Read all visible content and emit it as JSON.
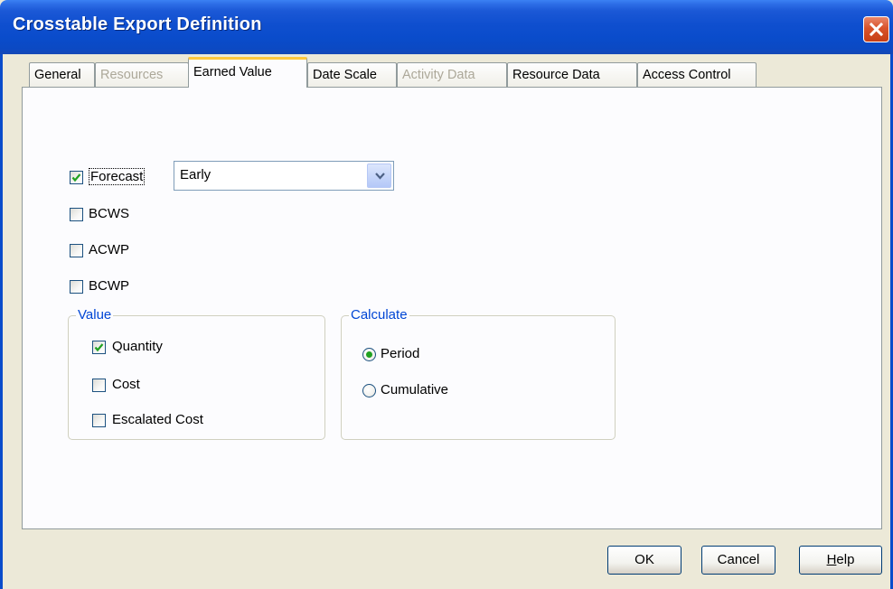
{
  "window": {
    "title": "Crosstable Export Definition"
  },
  "tabs": [
    {
      "label": "General",
      "state": "normal"
    },
    {
      "label": "Resources",
      "state": "disabled"
    },
    {
      "label": "Earned Value",
      "state": "active"
    },
    {
      "label": "Date Scale",
      "state": "normal"
    },
    {
      "label": "Activity Data",
      "state": "disabled"
    },
    {
      "label": "Resource  Data",
      "state": "normal"
    },
    {
      "label": "Access Control",
      "state": "normal"
    }
  ],
  "options": {
    "forecast": {
      "label": "Forecast",
      "checked": true,
      "select_value": "Early"
    },
    "bcws": {
      "label": "BCWS",
      "checked": false
    },
    "acwp": {
      "label": "ACWP",
      "checked": false
    },
    "bcwp": {
      "label": "BCWP",
      "checked": false
    }
  },
  "value_group": {
    "title": "Value",
    "quantity": {
      "label": "Quantity",
      "checked": true
    },
    "cost": {
      "label": "Cost",
      "checked": false
    },
    "escalated_cost": {
      "label": "Escalated Cost",
      "checked": false
    }
  },
  "calculate_group": {
    "title": "Calculate",
    "period": {
      "label": "Period",
      "selected": true
    },
    "cumulative": {
      "label": "Cumulative",
      "selected": false
    }
  },
  "buttons": {
    "ok": "OK",
    "cancel": "Cancel",
    "help_mnemonic": "H",
    "help_rest": "elp"
  },
  "colors": {
    "title_bar": "#0A4CCB",
    "dialog_bg": "#ECE9D8",
    "active_tab_highlight": "#FFC83C",
    "group_title": "#0046D5",
    "check_mark": "#21A121"
  },
  "icons": {
    "close": "close-icon",
    "combo_arrow": "chevron-down-icon",
    "check": "checkmark-icon"
  }
}
